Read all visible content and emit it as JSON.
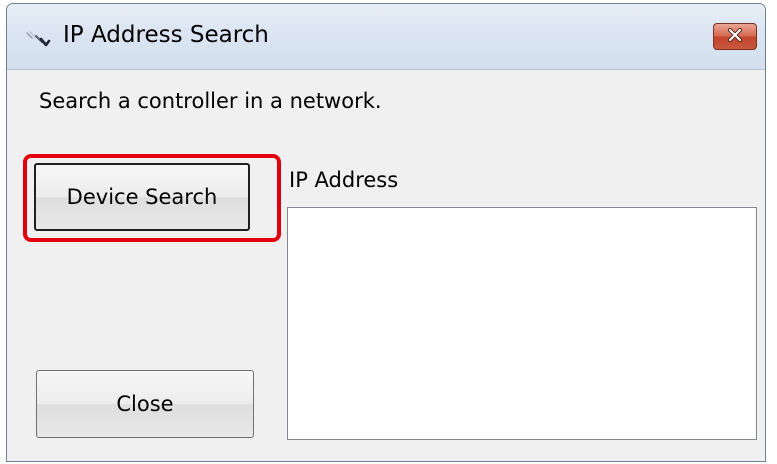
{
  "window": {
    "title": "IP Address Search",
    "icons": {
      "app": "ip-search-app-icon",
      "close": "close-x-icon"
    },
    "close_button_color": "#c9583e"
  },
  "content": {
    "instruction": "Search a controller in a network.",
    "device_search_label": "Device Search",
    "close_label": "Close",
    "ip_address_label": "IP Address",
    "ip_address_items": []
  },
  "annotation": {
    "highlight_color": "#e3000f"
  }
}
